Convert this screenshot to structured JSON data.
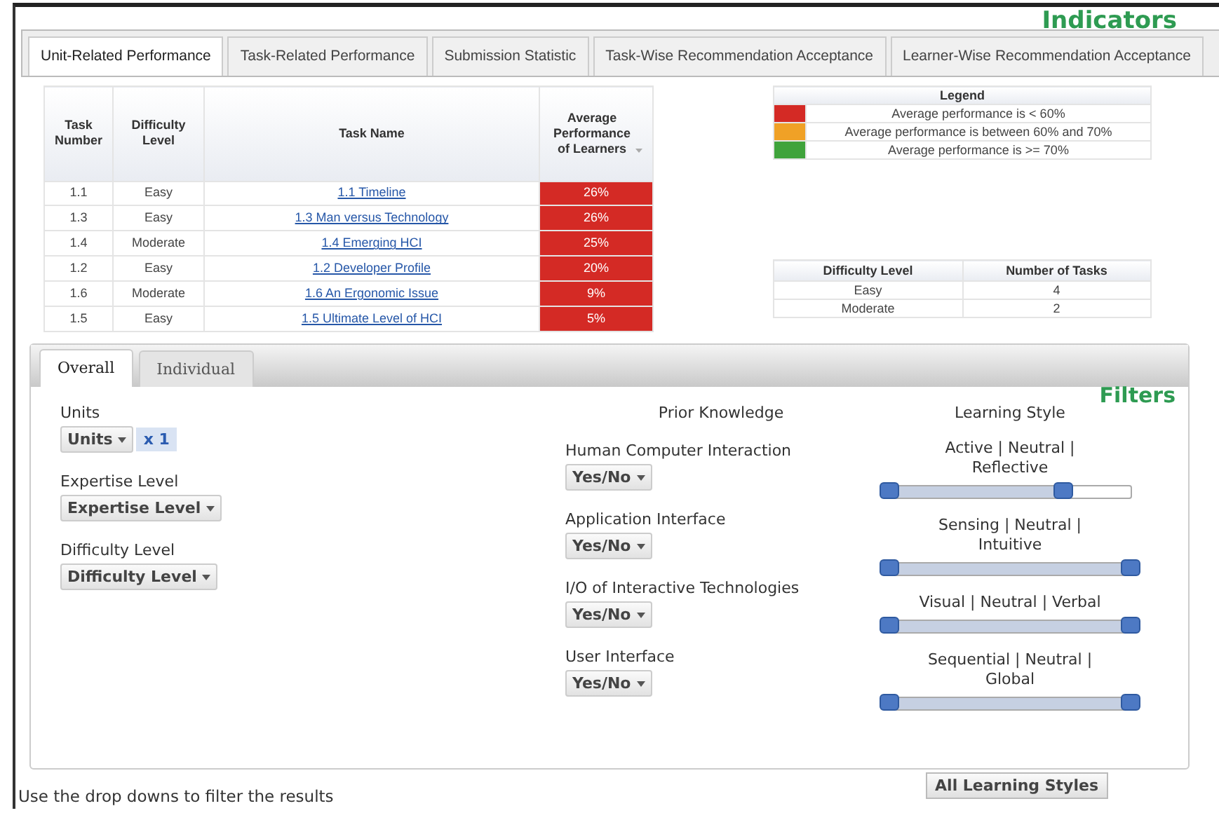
{
  "heading": "Indicators",
  "tabs": [
    {
      "label": "Unit-Related Performance",
      "selected": true
    },
    {
      "label": "Task-Related Performance",
      "selected": false
    },
    {
      "label": "Submission Statistic",
      "selected": false
    },
    {
      "label": "Task-Wise Recommendation Acceptance",
      "selected": false
    },
    {
      "label": "Learner-Wise Recommendation Acceptance",
      "selected": false
    }
  ],
  "performance_table": {
    "columns": [
      "Task Number",
      "Difficulty Level",
      "Task Name",
      "Average Performance of Learners"
    ],
    "rows": [
      {
        "task_number": "1.1",
        "difficulty": "Easy",
        "task_name": "1.1 Timeline",
        "performance": "26%",
        "color": "#d42a25"
      },
      {
        "task_number": "1.3",
        "difficulty": "Easy",
        "task_name": "1.3 Man versus Technology",
        "performance": "26%",
        "color": "#d42a25"
      },
      {
        "task_number": "1.4",
        "difficulty": "Moderate",
        "task_name": "1.4 Emerging HCI",
        "performance": "25%",
        "color": "#d42a25"
      },
      {
        "task_number": "1.2",
        "difficulty": "Easy",
        "task_name": "1.2 Developer Profile",
        "performance": "20%",
        "color": "#d42a25"
      },
      {
        "task_number": "1.6",
        "difficulty": "Moderate",
        "task_name": "1.6 An Ergonomic Issue",
        "performance": "9%",
        "color": "#d42a25"
      },
      {
        "task_number": "1.5",
        "difficulty": "Easy",
        "task_name": "1.5 Ultimate Level of HCI",
        "performance": "5%",
        "color": "#d42a25"
      }
    ]
  },
  "legend": {
    "title": "Legend",
    "items": [
      {
        "label": "Average performance is < 60%",
        "color": "#d42a25"
      },
      {
        "label": "Average performance is between 60% and 70%",
        "color": "#f0a126"
      },
      {
        "label": "Average performance is >= 70%",
        "color": "#3fa33b"
      }
    ]
  },
  "difficulty_table": {
    "columns": [
      "Difficulty Level",
      "Number of Tasks"
    ],
    "rows": [
      [
        "Easy",
        "4"
      ],
      [
        "Moderate",
        "2"
      ]
    ]
  },
  "filters": {
    "heading": "Filters",
    "tabs": [
      {
        "label": "Overall",
        "selected": true
      },
      {
        "label": "Individual",
        "selected": false
      }
    ],
    "general": [
      {
        "label": "Units",
        "dropdown": "Units",
        "chip": "x 1"
      },
      {
        "label": "Expertise Level",
        "dropdown": "Expertise Level"
      },
      {
        "label": "Difficulty Level",
        "dropdown": "Difficulty Level"
      }
    ],
    "prior_knowledge": {
      "title": "Prior Knowledge",
      "items": [
        {
          "label": "Human Computer Interaction",
          "dropdown": "Yes/No"
        },
        {
          "label": "Application Interface",
          "dropdown": "Yes/No"
        },
        {
          "label": "I/O of Interactive Technologies",
          "dropdown": "Yes/No"
        },
        {
          "label": "User Interface",
          "dropdown": "Yes/No"
        }
      ]
    },
    "learning_style": {
      "title": "Learning Style",
      "sliders": [
        {
          "label": "Active | Neutral | Reflective",
          "level": 0.72
        },
        {
          "label": "Sensing | Neutral | Intuitive",
          "level": 1
        },
        {
          "label": "Visual | Neutral | Verbal",
          "level": 1
        },
        {
          "label": "Sequential | Neutral | Global",
          "level": 1
        }
      ]
    },
    "button": "All Learning Styles",
    "hint": "Use the drop downs to filter the results"
  }
}
